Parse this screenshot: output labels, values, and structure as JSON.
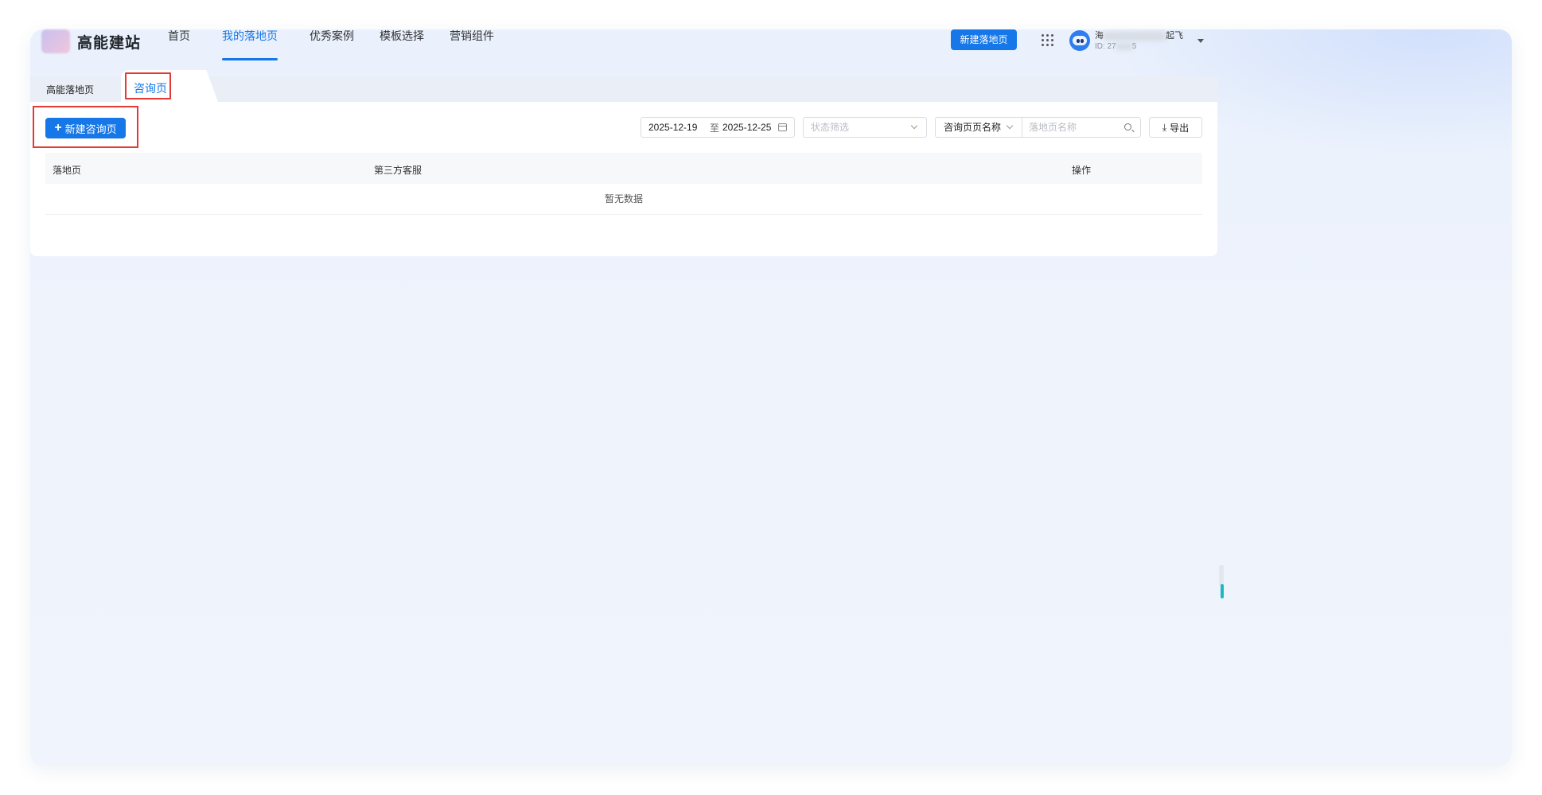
{
  "brand": {
    "name": "高能建站"
  },
  "nav": {
    "items": [
      {
        "label": "首页",
        "active": false
      },
      {
        "label": "我的落地页",
        "active": true
      },
      {
        "label": "优秀案例",
        "active": false
      },
      {
        "label": "模板选择",
        "active": false
      },
      {
        "label": "营销组件",
        "active": false
      }
    ]
  },
  "header": {
    "new_landing_label": "新建落地页",
    "user_name_start": "海",
    "user_name_end": "起飞",
    "user_id_prefix": "ID: 27",
    "user_id_suffix": "5"
  },
  "tabs": {
    "items": [
      {
        "label": "高能落地页",
        "active": false
      },
      {
        "label": "咨询页",
        "active": true
      }
    ]
  },
  "toolbar": {
    "new_label": "新建咨询页",
    "date_start": "2025-12-19",
    "date_sep": "至",
    "date_end": "2025-12-25",
    "status_placeholder": "状态筛选",
    "search_type": "咨询页页名称",
    "search_placeholder": "落地页名称",
    "export_label": "导出"
  },
  "table": {
    "columns": [
      "落地页",
      "第三方客服",
      "操作"
    ],
    "empty_text": "暂无数据"
  },
  "colors": {
    "primary": "#1677e8",
    "highlight": "#e53935"
  }
}
